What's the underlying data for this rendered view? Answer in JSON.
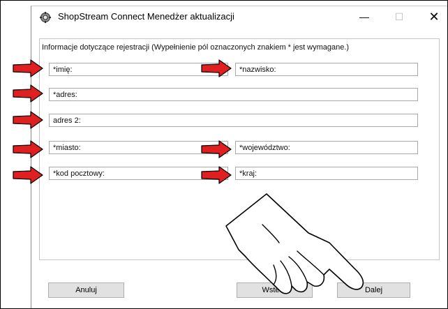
{
  "window": {
    "title": "ShopStream Connect Menedżer aktualizacji",
    "minimize_glyph": "—",
    "maximize_glyph": "☐",
    "close_glyph": "✕"
  },
  "form": {
    "section_label": "Informacje dotyczące rejestracji  (Wypełnienie pól oznaczonych znakiem * jest wymagane.)",
    "fields": {
      "first_name": "*imię:",
      "last_name": "*nazwisko:",
      "address": "*adres:",
      "address2": "adres 2:",
      "city": "*miasto:",
      "province": "*województwo:",
      "postal_code": "*kod pocztowy:",
      "country": "*kraj:"
    }
  },
  "buttons": {
    "cancel": "Anuluj",
    "back": "Wstecz",
    "next": "Dalej"
  },
  "colors": {
    "arrow_fill": "#e02020",
    "arrow_outline": "#000000"
  },
  "icons": {
    "app": "shopstream-gear-icon",
    "pointer": "pointing-hand-icon",
    "callout": "red-arrow-icon"
  }
}
